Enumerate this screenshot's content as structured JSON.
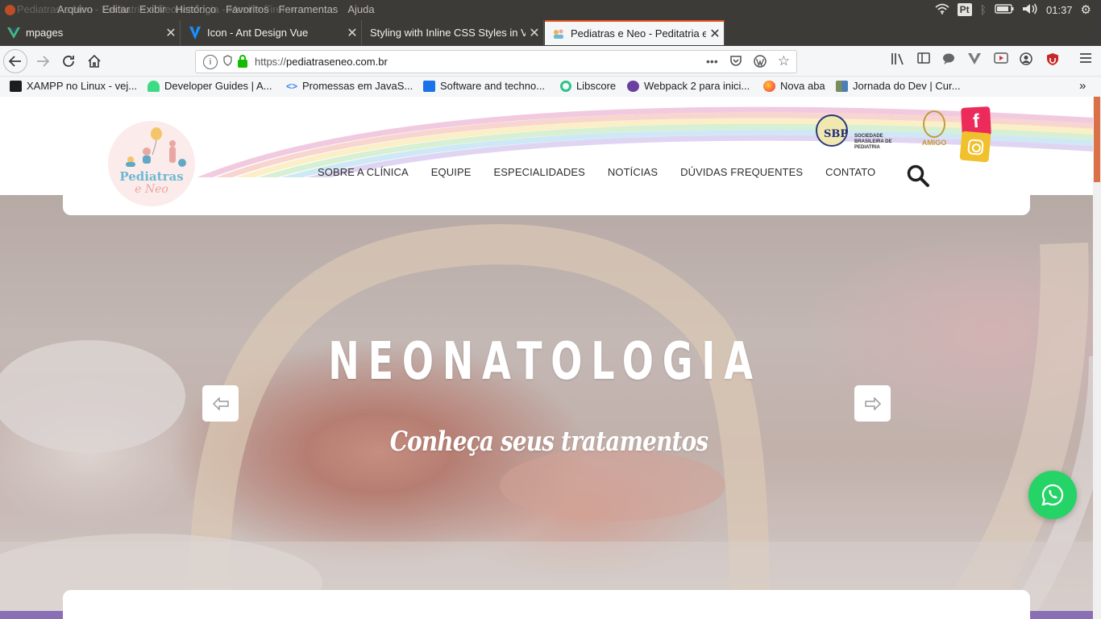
{
  "system": {
    "menu": [
      "Arquivo",
      "Editar",
      "Exibir",
      "Histórico",
      "Favoritos",
      "Ferramentas",
      "Ajuda"
    ],
    "ghost_title": "Pediatras e Neo - Peditatria e Neonatologia - Mozilla Firefox",
    "keyboard": "Pt",
    "clock": "01:37"
  },
  "tabs": [
    {
      "label": "mpages",
      "icon": "vue-icon"
    },
    {
      "label": "Icon - Ant Design Vue",
      "icon": "vue-antd-icon"
    },
    {
      "label": "Styling with Inline CSS Styles in V",
      "icon": ""
    },
    {
      "label": "Pediatras e Neo - Peditatria e",
      "icon": "pediatras-favicon"
    }
  ],
  "url": {
    "prefix": "https://",
    "domain": "pediatraseneo.com.br"
  },
  "bookmarks": [
    {
      "label": "XAMPP no Linux - vej...",
      "color": "#1d1d1d"
    },
    {
      "label": "Developer Guides | A...",
      "color": "#3ddc84"
    },
    {
      "label": "Promessas em JavaS...",
      "color": "#4285f4"
    },
    {
      "label": "Software and techno...",
      "color": "#1a73e8"
    },
    {
      "label": "Libscore",
      "color": "#2bc48a"
    },
    {
      "label": "Webpack 2 para inici...",
      "color": "#6a3fa0"
    },
    {
      "label": "Nova aba",
      "color": "#ff7139"
    },
    {
      "label": "Jornada do Dev | Cur...",
      "color": "#7a8c5e"
    }
  ],
  "site": {
    "logo_name": "Pediatras",
    "logo_sub": "e Neo",
    "nav": [
      "SOBRE A CLÍNICA",
      "EQUIPE",
      "ESPECIALIDADES",
      "NOTÍCIAS",
      "DÚVIDAS FREQUENTES",
      "CONTATO"
    ],
    "sbp_letters": "SBP",
    "sbp_text": "SOCIEDADE BRASILEIRA DE PEDIATRIA",
    "amigo_label": "AMIGO",
    "facebook_letter": "f",
    "slide_title": "NEONATOLOGIA",
    "slide_subtitle": "Conheça seus tratamentos"
  },
  "colors": {
    "accent": "#e95420",
    "brand_purple": "#8a6fb7",
    "whatsapp": "#25d366",
    "facebook": "#ec2b5a",
    "instagram": "#f1c02d"
  }
}
